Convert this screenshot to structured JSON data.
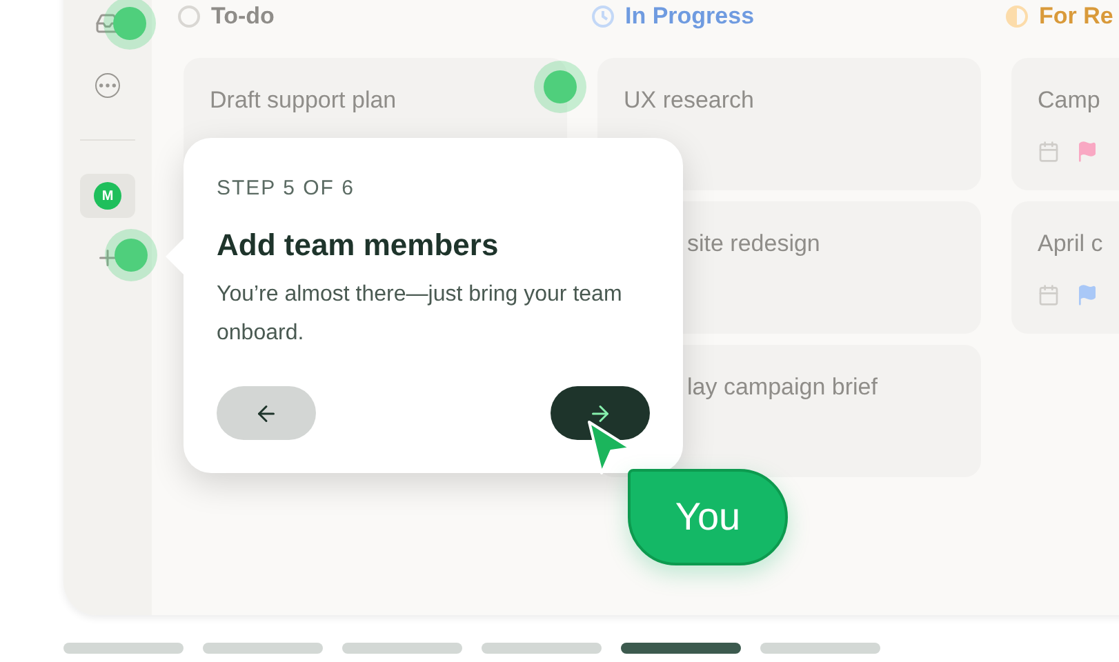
{
  "sidebar": {
    "avatar": "M"
  },
  "columns": [
    {
      "title": "To-do",
      "kind": "todo",
      "cards": [
        {
          "title": "Draft support plan"
        }
      ]
    },
    {
      "title": "In Progress",
      "kind": "progress",
      "cards": [
        {
          "title": "UX research"
        },
        {
          "title": "site redesign"
        },
        {
          "title": "lay campaign brief"
        }
      ]
    },
    {
      "title": "For Re",
      "kind": "review",
      "cards": [
        {
          "title": "Camp",
          "color": "#f9a8c3"
        },
        {
          "title": "April c",
          "color": "#a9c8f7"
        }
      ]
    }
  ],
  "tour": {
    "step": "STEP 5 OF 6",
    "title": "Add team members",
    "body": "You’re almost there—just bring your team onboard."
  },
  "cursor": {
    "label": "You"
  },
  "pagination": [
    {
      "selected": false
    },
    {
      "selected": false
    },
    {
      "selected": false
    },
    {
      "selected": false
    },
    {
      "selected": true
    },
    {
      "selected": false
    }
  ]
}
